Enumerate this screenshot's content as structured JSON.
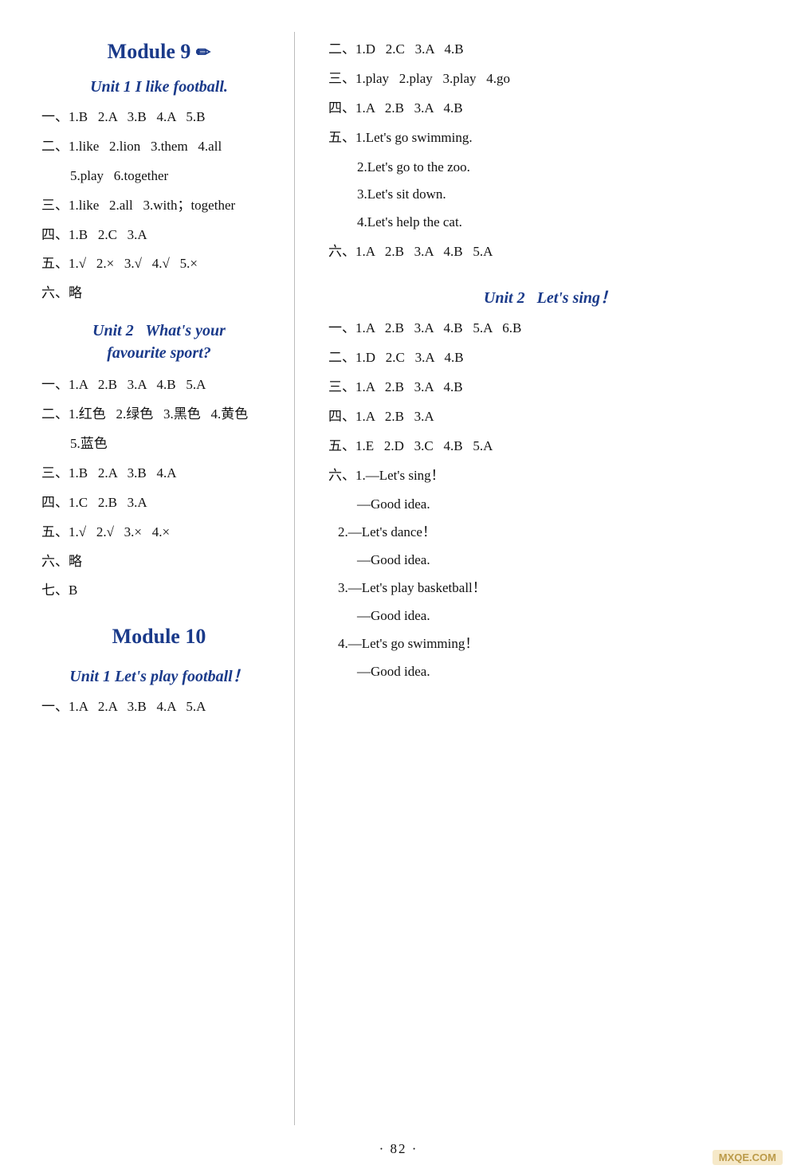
{
  "page": {
    "number": "· 82 ·",
    "watermark": "MXQE.COM"
  },
  "left": {
    "module9": {
      "title": "Module 9",
      "unit1": {
        "title": "Unit 1   I like football.",
        "answers": [
          "一、1.B   2.A   3.B   4.A   5.B",
          "二、1.like   2.lion   3.them   4.all",
          "    5.play   6.together",
          "三、1.like   2.all   3.with；together",
          "四、1.B   2.C   3.A",
          "五、1.√   2.×   3.√   4.√   5.×",
          "六、略"
        ]
      },
      "unit2": {
        "title_line1": "Unit 2   What's your",
        "title_line2": "favourite sport?",
        "answers": [
          "一、1.A   2.B   3.A   4.B   5.A",
          "二、1.红色   2.绿色   3.黑色   4.黄色",
          "    5.蓝色",
          "三、1.B   2.A   3.B   4.A",
          "四、1.C   2.B   3.A",
          "五、1.√   2.√   3.×   4.×",
          "六、略",
          "七、B"
        ]
      }
    },
    "module10": {
      "title": "Module 10",
      "unit1": {
        "title": "Unit 1   Let's play football！",
        "answers": [
          "一、1.A   2.A   3.B   4.A   5.A"
        ]
      }
    }
  },
  "right": {
    "module10_unit1_cont": {
      "answers": [
        "二、1.D   2.C   3.A   4.B",
        "三、1.play   2.play   3.play   4.go",
        "四、1.A   2.B   3.A   4.B",
        "五、1.Let's go swimming.",
        "    2.Let's go to the zoo.",
        "    3.Let's sit down.",
        "    4.Let's help the cat.",
        "六、1.A   2.B   3.A   4.B   5.A"
      ]
    },
    "unit2": {
      "title": "Unit 2   Let's sing！",
      "answers": [
        "一、1.A   2.B   3.A   4.B   5.A   6.B",
        "二、1.D   2.C   3.A   4.B",
        "三、1.A   2.B   3.A   4.B",
        "四、1.A   2.B   3.A",
        "五、1.E   2.D   3.C   4.B   5.A",
        "六、1.—Let's sing！",
        "    —Good idea.",
        "    2.—Let's dance！",
        "    —Good idea.",
        "    3.—Let's play basketball！",
        "    —Good idea.",
        "    4.—Let's go swimming！",
        "    —Good idea."
      ]
    }
  }
}
